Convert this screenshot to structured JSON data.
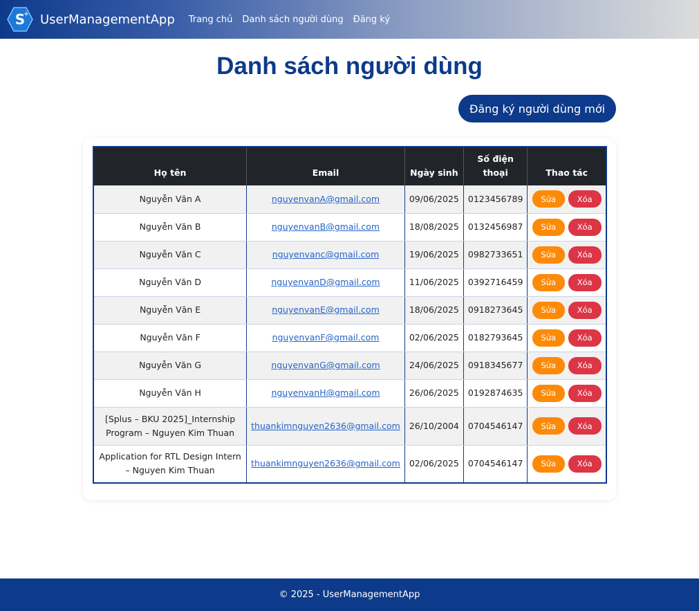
{
  "navbar": {
    "brand": "UserManagementApp",
    "links": [
      "Trang chủ",
      "Danh sách người dùng",
      "Đăng ký"
    ]
  },
  "page": {
    "title": "Danh sách người dùng",
    "new_button": "Đăng ký người dùng mới"
  },
  "table": {
    "headers": [
      "Họ tên",
      "Email",
      "Ngày sinh",
      "Số điện thoại",
      "Thao tác"
    ],
    "rows": [
      {
        "name": "Nguyễn Văn A",
        "email": "nguyenvanA@gmail.com",
        "dob": "09/06/2025",
        "phone": "0123456789"
      },
      {
        "name": "Nguyễn Văn B",
        "email": "nguyenvanB@gmail.com",
        "dob": "18/08/2025",
        "phone": "0132456987"
      },
      {
        "name": "Nguyễn Văn C",
        "email": "nguyenvanc@gmail.com",
        "dob": "19/06/2025",
        "phone": "0982733651"
      },
      {
        "name": "Nguyễn Văn D",
        "email": "nguyenvanD@gmail.com",
        "dob": "11/06/2025",
        "phone": "0392716459"
      },
      {
        "name": "Nguyễn Văn E",
        "email": "nguyenvanE@gmail.com",
        "dob": "18/06/2025",
        "phone": "0918273645"
      },
      {
        "name": "Nguyễn Văn F",
        "email": "nguyenvanF@gmail.com",
        "dob": "02/06/2025",
        "phone": "0182793645"
      },
      {
        "name": "Nguyễn Văn G",
        "email": "nguyenvanG@gmail.com",
        "dob": "24/06/2025",
        "phone": "0918345677"
      },
      {
        "name": "Nguyễn Văn H",
        "email": "nguyenvanH@gmail.com",
        "dob": "26/06/2025",
        "phone": "0192874635"
      },
      {
        "name": "[Splus – BKU 2025]_Internship Program – Nguyen Kim Thuan",
        "email": "thuankimnguyen2636@gmail.com",
        "dob": "26/10/2004",
        "phone": "0704546147"
      },
      {
        "name": "Application for RTL Design Intern – Nguyen Kim Thuan",
        "email": "thuankimnguyen2636@gmail.com",
        "dob": "02/06/2025",
        "phone": "0704546147"
      }
    ],
    "edit_label": "Sửa",
    "delete_label": "Xóa"
  },
  "footer": {
    "text": "© 2025 - UserManagementApp"
  },
  "colors": {
    "primary": "#0d3a8a",
    "edit": "#fd8a07",
    "delete": "#dc3545",
    "header_bg": "#212529"
  }
}
